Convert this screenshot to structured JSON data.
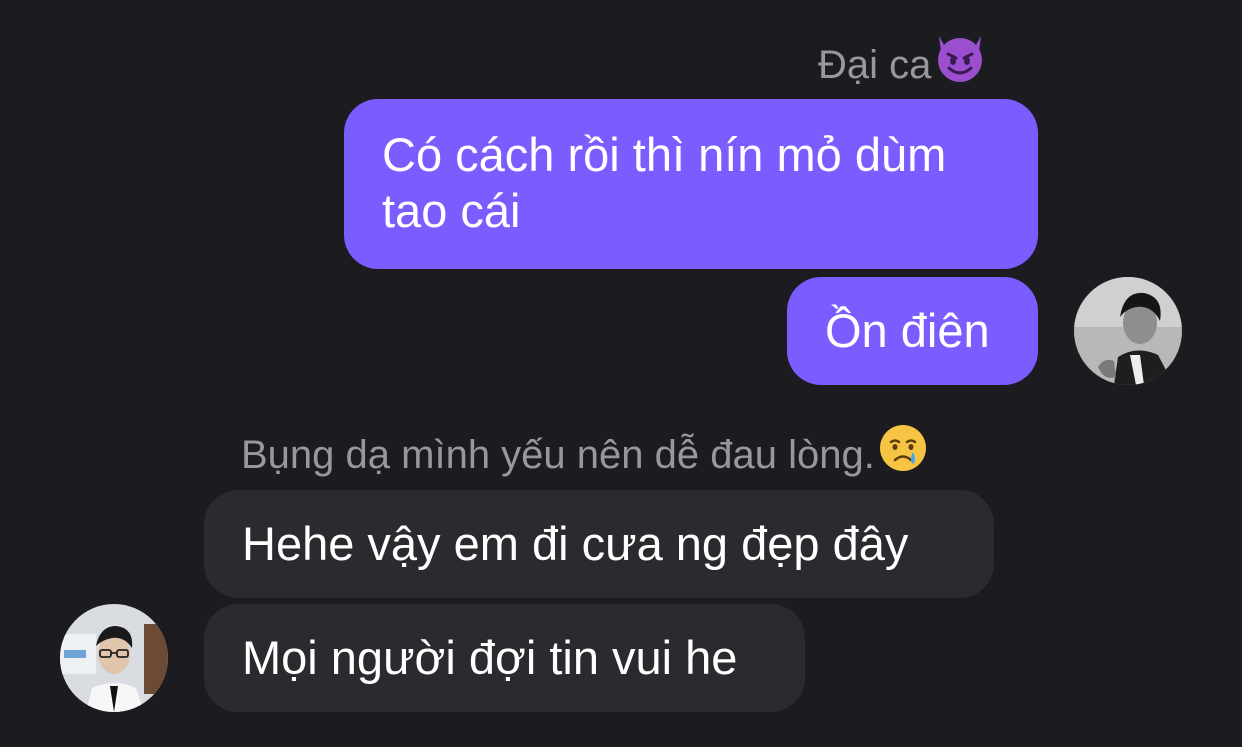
{
  "conversation": {
    "outgoing_group": {
      "sender_name": "Đại ca",
      "sender_emoji": "smiling-face-with-horns-icon",
      "messages": [
        {
          "line1": "Có cách rồi thì nín mỏ dùm",
          "line2": "tao cái"
        },
        {
          "text": "Ồn điên"
        }
      ]
    },
    "incoming_group": {
      "sender_name": "Bụng dạ mình yếu nên dễ đau lòng.",
      "sender_emoji": "crying-face-icon",
      "messages": [
        {
          "text": "Hehe vậy em đi cưa ng đẹp đây"
        },
        {
          "text": "Mọi người đợi tin vui he"
        }
      ]
    }
  },
  "colors": {
    "background": "#1c1b1f",
    "outgoing_bubble": "#7b5cff",
    "incoming_bubble": "#2b2a2f",
    "sender_name": "#98979c"
  }
}
